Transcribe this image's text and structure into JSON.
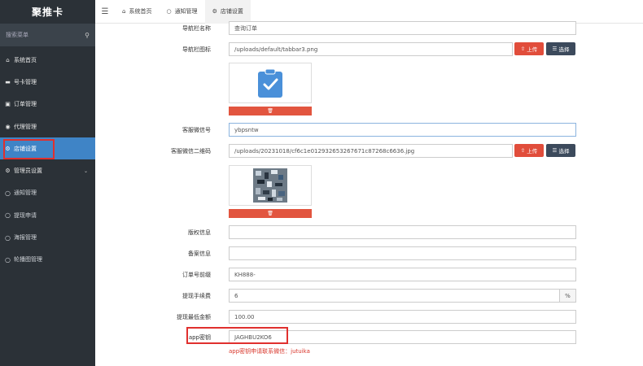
{
  "app": {
    "brand": "聚推卡"
  },
  "search": {
    "placeholder": "搜索菜单"
  },
  "sidebar": {
    "items": [
      {
        "label": "系统首页",
        "icon": "home-icon"
      },
      {
        "label": "号卡管理",
        "icon": "card-icon"
      },
      {
        "label": "订单管理",
        "icon": "file-icon"
      },
      {
        "label": "代理管理",
        "icon": "users-icon"
      },
      {
        "label": "店铺设置",
        "icon": "gears-icon",
        "active": true
      },
      {
        "label": "管理员设置",
        "icon": "gears-icon",
        "expandable": true
      },
      {
        "label": "通知管理",
        "icon": "circle-icon"
      },
      {
        "label": "提现申请",
        "icon": "circle-icon"
      },
      {
        "label": "海报管理",
        "icon": "circle-icon"
      },
      {
        "label": "轮播图管理",
        "icon": "circle-icon"
      }
    ]
  },
  "tabs": [
    {
      "label": "系统首页",
      "icon": "home-icon"
    },
    {
      "label": "通知管理",
      "icon": "circle-icon"
    },
    {
      "label": "店铺设置",
      "icon": "gears-icon",
      "active": true
    }
  ],
  "form": {
    "nav_name": {
      "label": "导航栏名称",
      "value": "查询订单"
    },
    "nav_icon": {
      "label": "导航栏图标",
      "value": "/uploads/default/tabbar3.png"
    },
    "kefu_wechat": {
      "label": "客服微信号",
      "value": "ybpsntw"
    },
    "kefu_qr": {
      "label": "客服微信二维码",
      "value": "/uploads/20231018/cf6c1e012932653267671c87268c6636.jpg"
    },
    "copyright": {
      "label": "版权信息",
      "value": ""
    },
    "beian": {
      "label": "备案信息",
      "value": ""
    },
    "order_prefix": {
      "label": "订单号前缀",
      "value": "KH888-"
    },
    "withdraw_fee": {
      "label": "提现手续费",
      "value": "6",
      "unit": "%"
    },
    "withdraw_min": {
      "label": "提现最低金额",
      "value": "100.00"
    },
    "app_key": {
      "label": "app密钥",
      "value": "JAGHBU2KO6"
    },
    "app_key_hint": "app密钥申请联系微信：jutuika",
    "upload_label": "上传",
    "choose_label": "选择"
  },
  "colors": {
    "sidebar_bg": "#2b3137",
    "active": "#3f84c6",
    "danger": "#e14d3b",
    "dark_btn": "#3c4a5c",
    "highlight": "#e0302e"
  }
}
